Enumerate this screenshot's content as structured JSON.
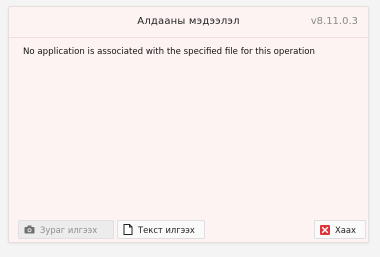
{
  "dialog": {
    "title": "Алдааны мэдээлэл",
    "version": "v8.11.0.3",
    "message": "No application is associated with the specified file for this operation"
  },
  "buttons": {
    "save_photo": {
      "label": "Зураг илгээх",
      "icon": "camera-icon",
      "enabled": false
    },
    "send_text": {
      "label": "Текст илгээх",
      "icon": "document-icon",
      "enabled": true
    },
    "close": {
      "label": "Хаах",
      "icon": "close-icon",
      "icon_color": "#e0353b"
    }
  }
}
